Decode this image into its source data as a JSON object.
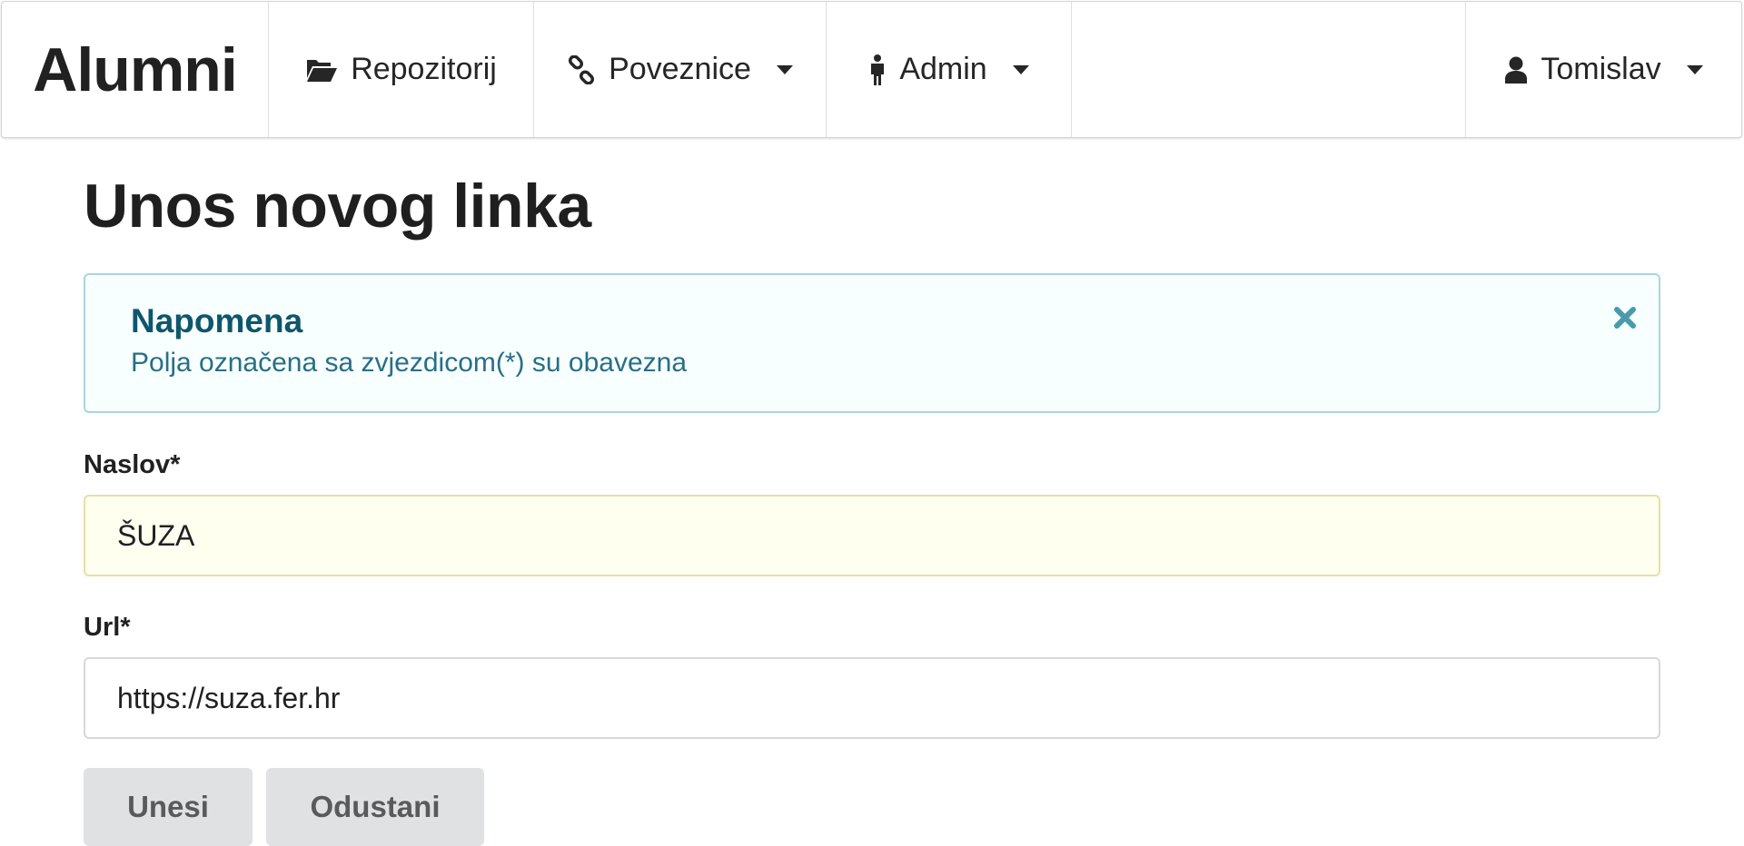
{
  "navbar": {
    "brand": "Alumni",
    "items": [
      {
        "label": "Repozitorij",
        "icon": "folder-open-icon"
      },
      {
        "label": "Poveznice",
        "icon": "chain-icon",
        "dropdown": true
      },
      {
        "label": "Admin",
        "icon": "male-icon",
        "dropdown": true
      }
    ],
    "user": {
      "label": "Tomislav",
      "icon": "user-icon",
      "dropdown": true
    }
  },
  "page": {
    "title": "Unos novog linka"
  },
  "message": {
    "header": "Napomena",
    "content": "Polja označena sa zvjezdicom(*) su obavezna",
    "color": "#0e566c",
    "background": "#f8ffff"
  },
  "form": {
    "title_label": "Naslov*",
    "title_value": "ŠUZA",
    "url_label": "Url*",
    "url_value": "https://suza.fer.hr",
    "submit_label": "Unesi",
    "cancel_label": "Odustani"
  }
}
